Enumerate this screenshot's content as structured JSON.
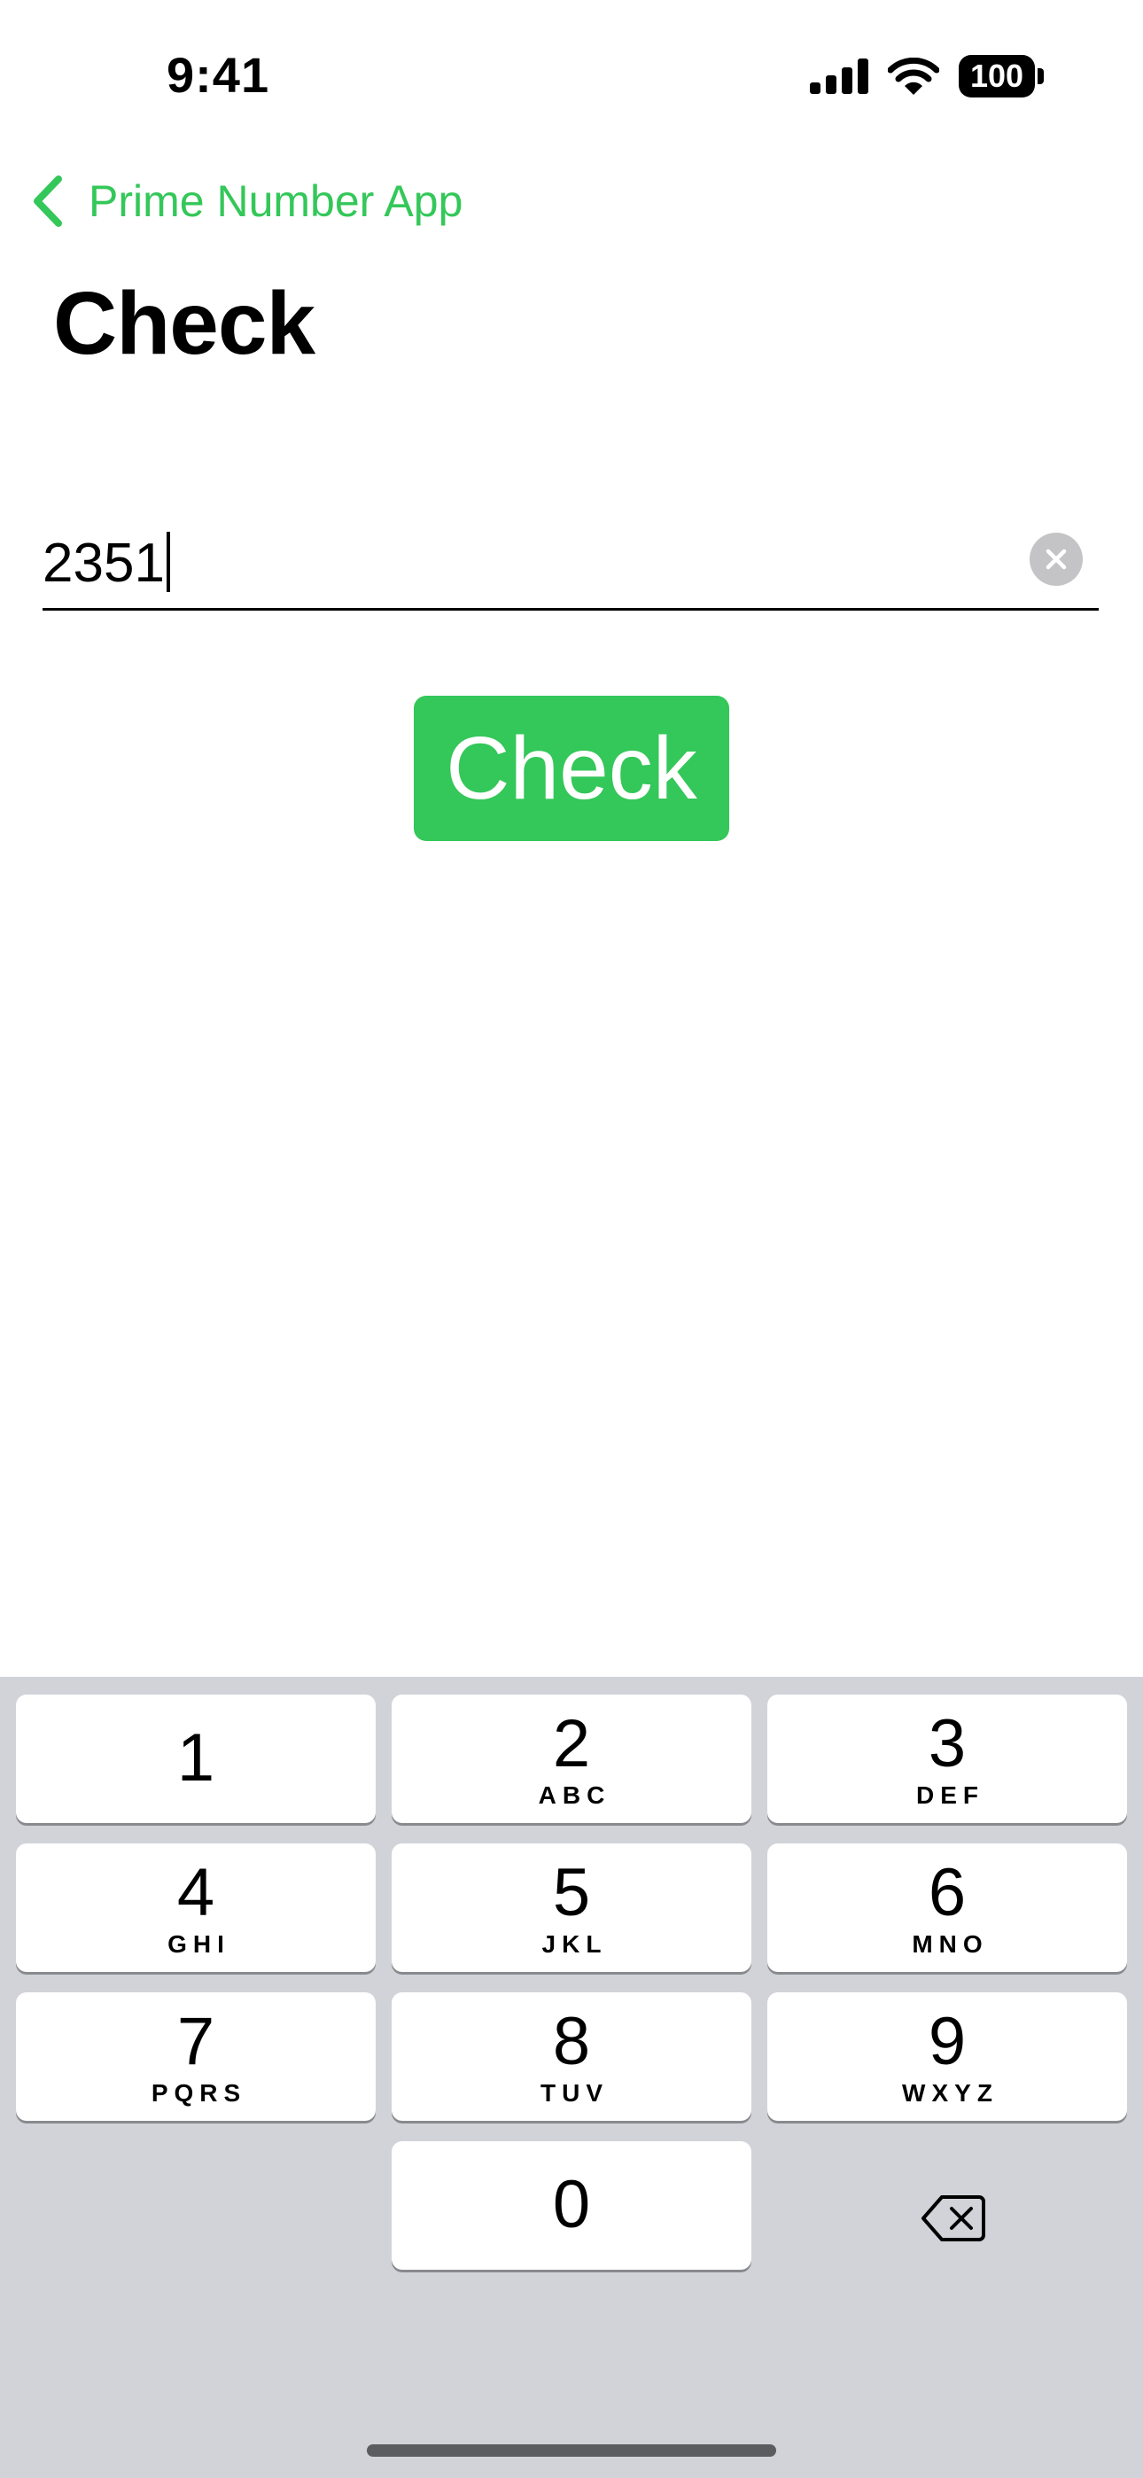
{
  "status_bar": {
    "time": "9:41",
    "battery_level": "100"
  },
  "nav": {
    "back_label": "Prime Number App"
  },
  "title": "Check",
  "input": {
    "value": "2351"
  },
  "check_button": {
    "label": "Check"
  },
  "colors": {
    "accent": "#34c759",
    "keyboard_bg": "#d1d3d9",
    "clear_button": "#c4c4c7"
  },
  "keypad": {
    "keys": [
      {
        "digit": "1",
        "letters": ""
      },
      {
        "digit": "2",
        "letters": "ABC"
      },
      {
        "digit": "3",
        "letters": "DEF"
      },
      {
        "digit": "4",
        "letters": "GHI"
      },
      {
        "digit": "5",
        "letters": "JKL"
      },
      {
        "digit": "6",
        "letters": "MNO"
      },
      {
        "digit": "7",
        "letters": "PQRS"
      },
      {
        "digit": "8",
        "letters": "TUV"
      },
      {
        "digit": "9",
        "letters": "WXYZ"
      },
      {
        "digit": "0",
        "letters": ""
      }
    ],
    "delete_icon": "delete-backspace-icon"
  }
}
